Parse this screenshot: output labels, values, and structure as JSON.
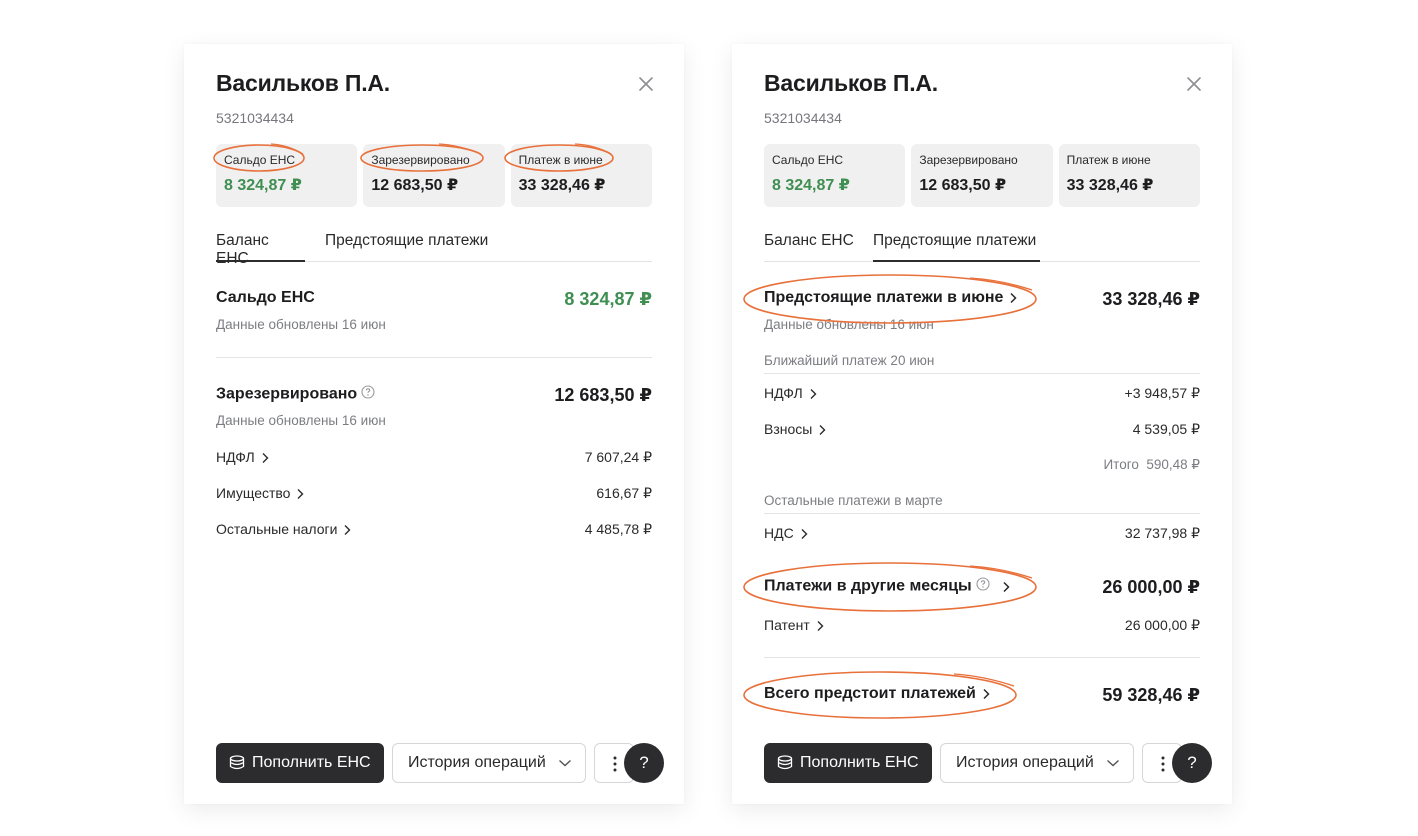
{
  "colors": {
    "accent_green": "#3f8e52",
    "highlight_orange": "#e8703a",
    "dark": "#2c2c2e"
  },
  "left": {
    "title": "Васильков П.А.",
    "inn": "5321034434",
    "cards": [
      {
        "label": "Сальдо ЕНС",
        "value": "8 324,87 ₽"
      },
      {
        "label": "Зарезервировано",
        "value": "12 683,50 ₽"
      },
      {
        "label": "Платеж в июне",
        "value": "33 328,46 ₽"
      }
    ],
    "tabs": [
      {
        "label": "Баланс ЕНС",
        "active": true
      },
      {
        "label": "Предстоящие платежи",
        "active": false
      }
    ],
    "saldo": {
      "label": "Сальдо ЕНС",
      "value": "8 324,87 ₽",
      "updated": "Данные обновлены 16 июн"
    },
    "reserved": {
      "label": "Зарезервировано",
      "value": "12 683,50 ₽",
      "updated": "Данные обновлены 16 июн",
      "items": [
        {
          "label": "НДФЛ",
          "value": "7 607,24 ₽"
        },
        {
          "label": "Имущество",
          "value": "616,67 ₽"
        },
        {
          "label": "Остальные налоги",
          "value": "4 485,78 ₽"
        }
      ]
    },
    "buttons": {
      "topup": "Пополнить ЕНС",
      "history": "История операций",
      "help": "?"
    }
  },
  "right": {
    "title": "Васильков П.А.",
    "inn": "5321034434",
    "cards": [
      {
        "label": "Сальдо ЕНС",
        "value": "8 324,87 ₽"
      },
      {
        "label": "Зарезервировано",
        "value": "12 683,50 ₽"
      },
      {
        "label": "Платеж в июне",
        "value": "33 328,46 ₽"
      }
    ],
    "tabs": [
      {
        "label": "Баланс ЕНС",
        "active": false
      },
      {
        "label": "Предстоящие платежи",
        "active": true
      }
    ],
    "upcoming_june": {
      "label": "Предстоящие платежи в июне",
      "value": "33 328,46 ₽",
      "updated": "Данные обновлены 16 июн"
    },
    "nearest": {
      "label": "Ближайший платеж 20 июн",
      "items": [
        {
          "label": "НДФЛ",
          "value": "+3 948,57 ₽"
        },
        {
          "label": "Взносы",
          "value": "4 539,05 ₽"
        }
      ],
      "total_label": "Итого",
      "total_value": "590,48 ₽"
    },
    "others_march": {
      "label": "Остальные платежи в марте",
      "items": [
        {
          "label": "НДС",
          "value": "32 737,98 ₽"
        }
      ]
    },
    "other_months": {
      "label": "Платежи в другие месяцы",
      "value": "26 000,00 ₽",
      "items": [
        {
          "label": "Патент",
          "value": "26 000,00 ₽"
        }
      ]
    },
    "total_upcoming": {
      "label": "Всего предстоит платежей",
      "value": "59 328,46 ₽"
    },
    "buttons": {
      "topup": "Пополнить ЕНС",
      "history": "История операций",
      "help": "?"
    }
  }
}
